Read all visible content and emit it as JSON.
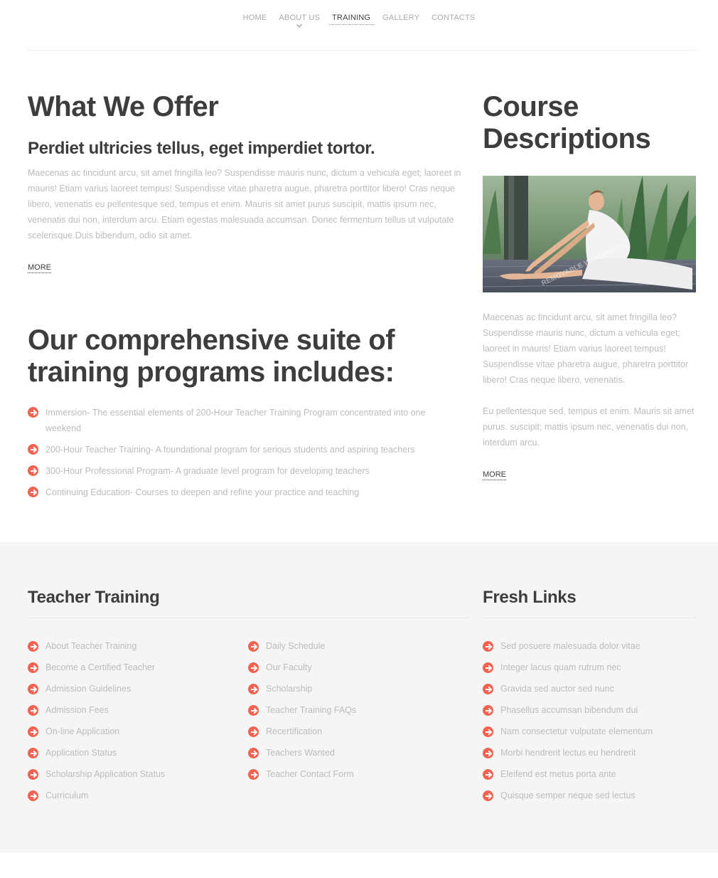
{
  "nav": {
    "items": [
      {
        "label": "HOME"
      },
      {
        "label": "ABOUT US"
      },
      {
        "label": "TRAINING"
      },
      {
        "label": "GALLERY"
      },
      {
        "label": "CONTACTS"
      }
    ],
    "active_index": 2
  },
  "offer": {
    "title": "What We Offer",
    "subtitle": "Perdiet ultricies tellus, eget imperdiet tortor.",
    "body": "Maecenas ac tincidunt arcu, sit amet fringilla leo? Suspendisse mauris nunc, dictum a vehicula eget; laoreet in mauris! Etiam varius laoreet tempus! Suspendisse vitae pharetra augue, pharetra porttitor libero! Cras neque libero, venenatis eu pellentesque sed, tempus et enim. Mauris sit amet purus suscipit, mattis ipsum nec, venenatis dui non, interdum arcu. Etiam egestas malesuada accumsan. Donec fermentum tellus ut vulputate scelerisque.Duis bibendum, odio sit amet.",
    "more_label": "MORE"
  },
  "suite": {
    "title": "Our comprehensive suite of training programs includes:",
    "items": [
      "Immersion- The essential elements of 200-Hour Teacher Training Program concentrated into one weekend",
      "200-Hour Teacher Training- A foundational program for serious students and aspiring teachers",
      "300-Hour Professional Program- A graduate level program for developing teachers",
      "Continuing Education- Courses to deepen and refine your practice and teaching"
    ]
  },
  "course": {
    "title": "Course Descriptions",
    "image_watermark": "REMOVABLE WATERMARK",
    "paragraph1": "Maecenas ac tincidunt arcu, sit amet fringilla leo? Suspendisse mauris nunc, dictum a vehicula eget; laoreet in mauris! Etiam varius laoreet tempus! Suspendisse vitae pharetra augue, pharetra porttitor libero! Cras neque libero, venenatis.",
    "paragraph2": "Eu pellentesque sed, tempus et enim. Mauris sit amet purus. suscipit; mattis ipsum nec, venenatis dui non, interdum arcu.",
    "more_label": "MORE"
  },
  "footer": {
    "teacher_training": {
      "title": "Teacher Training",
      "col1": [
        "About Teacher Training",
        "Become a Certified Teacher",
        "Admission Guidelines",
        "Admission Fees",
        "On-line Application",
        "Application Status",
        "Scholarship Application Status",
        "Curriculum"
      ],
      "col2": [
        "Daily Schedule",
        "Our Faculty",
        "Scholarship",
        "Teacher Training FAQs",
        "Recertification",
        "Teachers Wanted",
        "Teacher Contact Form"
      ]
    },
    "fresh_links": {
      "title": "Fresh Links",
      "items": [
        "Sed posuere malesuada dolor vitae",
        "Integer lacus quam rutrum nec",
        "Gravida sed auctor sed nunc",
        "Phasellus accumsan bibendum dui",
        "Nam consectetur vulputate elementum",
        "Morbi hendrerit lectus eu hendrerit",
        "Eleifend est metus porta ante",
        "Quisque semper neque sed lectus"
      ]
    }
  },
  "colors": {
    "accent": "#f16350",
    "heading": "#3d3d3d",
    "body_text": "#bcbcbc",
    "footer_bg": "#f5f5f5"
  },
  "icons": {
    "list_bullet": "arrow-right-circle-icon",
    "nav_dropdown": "chevron-down-icon"
  }
}
